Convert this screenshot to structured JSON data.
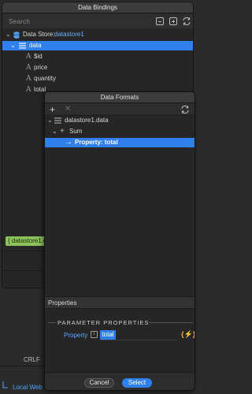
{
  "bindings": {
    "title": "Data Bindings",
    "search_placeholder": "Search",
    "datastore_label": "Data Store:",
    "datastore_name": "datastore1",
    "tree": [
      {
        "label": "data",
        "kind": "array"
      },
      {
        "label": "$id",
        "kind": "field"
      },
      {
        "label": "price",
        "kind": "field"
      },
      {
        "label": "quantity",
        "kind": "field"
      },
      {
        "label": "total",
        "kind": "field"
      }
    ],
    "chip_label": "{ datastore1.d"
  },
  "statusbar": {
    "line_ending": "CRLF",
    "local_web": "Local Web S"
  },
  "formats": {
    "title": "Data Formats",
    "tree": [
      {
        "label": "datastore1.data"
      },
      {
        "label": "Sum"
      },
      {
        "label": "Property: total"
      }
    ],
    "properties_header": "Properties",
    "parameter_header": "PARAMETER PROPERTIES",
    "property_label": "Property",
    "property_info": "i",
    "property_value": "total",
    "cancel_label": "Cancel",
    "select_label": "Select"
  },
  "colors": {
    "accent": "#2f80ed",
    "link": "#5ea7f5",
    "chip": "#8dc35a",
    "dynamic": "#f0b040"
  }
}
